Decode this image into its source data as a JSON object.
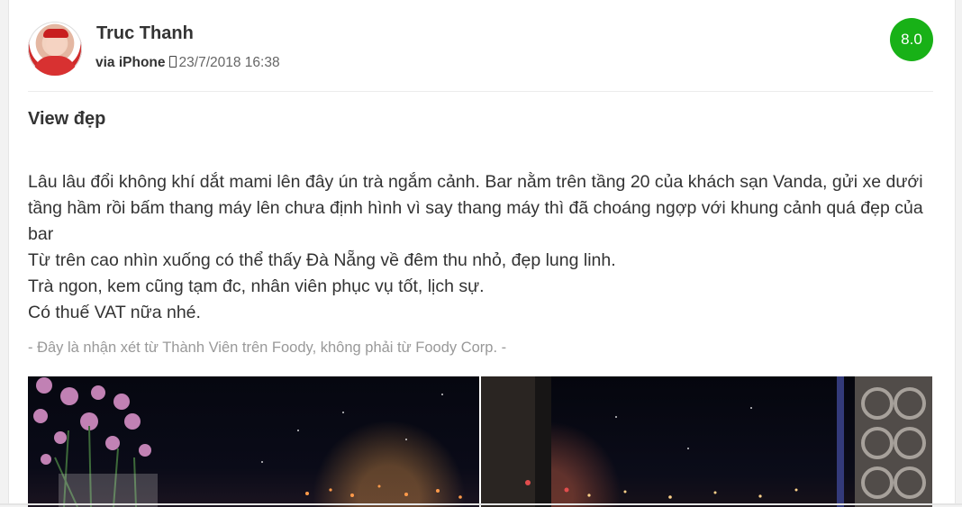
{
  "review": {
    "user_name": "Truc Thanh",
    "device": "via iPhone",
    "timestamp": "23/7/2018 16:38",
    "score": "8.0",
    "title": "View đẹp",
    "body": [
      "Lâu lâu đổi không khí dắt mami lên đây ún trà ngắm cảnh. Bar nằm trên tầng 20 của khách sạn Vanda, gửi xe dưới tầng hầm rồi bấm thang máy lên chưa định hình vì say thang máy thì đã choáng ngợp với khung cảnh quá đẹp của bar",
      "Từ trên cao nhìn xuống có thể thấy Đà Nẵng về đêm thu nhỏ, đẹp lung linh.",
      "Trà ngon, kem cũng tạm đc, nhân viên phục vụ tốt, lịch sự.",
      "Có thuế VAT nữa nhé."
    ],
    "disclaimer": "- Đây là nhận xét từ Thành Viên trên Foody, không phải từ Foody Corp. -"
  },
  "colors": {
    "score_badge": "#18b117",
    "text": "#333333",
    "muted": "#999999"
  },
  "icons": {
    "device": "phone-icon"
  }
}
